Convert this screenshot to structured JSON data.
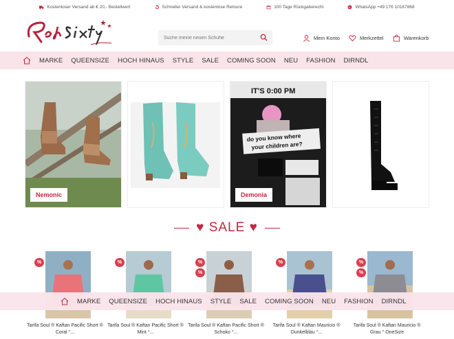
{
  "infobar": [
    {
      "icon": "truck-icon",
      "text": "Kostenloser Versand ab € 20,- Bestellwert"
    },
    {
      "icon": "return-icon",
      "text": "Schneller Versand & kostenlose Retoure"
    },
    {
      "icon": "calendar-icon",
      "text": "100 Tage Rückgaberecht"
    },
    {
      "icon": "whatsapp-icon",
      "text": "WhatsApp +49 176 10167868"
    }
  ],
  "brand": {
    "logo_text": "Red Sixty"
  },
  "search": {
    "placeholder": "Suche meine neuen Schuhe"
  },
  "account": {
    "konto": "Mein Konto",
    "merkzettel": "Merkzettel",
    "warenkorb": "Warenkorb"
  },
  "nav": [
    "MARKE",
    "QUEENSIZE",
    "HOCH HINAUS",
    "STYLE",
    "SALE",
    "COMING SOON",
    "NEU",
    "FASHION",
    "DIRNDL"
  ],
  "tiles": [
    {
      "label": "Nemonic"
    },
    {
      "label": ""
    },
    {
      "label": "Demonia",
      "poster_lines": [
        "IT'S 0:00 PM",
        "do you know where",
        "your children are?"
      ]
    },
    {
      "label": ""
    }
  ],
  "sale": {
    "title": "♥ SALE ♥"
  },
  "products": [
    {
      "badges": [
        "%"
      ],
      "name_line1": "Tarifa Soul ® Kaftan Pacific Short ®",
      "name_line2": "Coral °..."
    },
    {
      "badges": [
        "%"
      ],
      "name_line1": "Tarifa Soul ® Kaftan Pacific Short ®",
      "name_line2": "Mint °..."
    },
    {
      "badges": [
        "%",
        "%"
      ],
      "name_line1": "Tarifa Soul ® Kaftan Pacific Short ®",
      "name_line2": "Schoko °..."
    },
    {
      "badges": [
        "%"
      ],
      "name_line1": "Tarifa Soul ® Kaftan Mauricio ®",
      "name_line2": "Dunkelblau °..."
    },
    {
      "badges": [
        "%",
        "%"
      ],
      "name_line1": "Tarifa Soul ® Kaftan Mauricio ®",
      "name_line2": "Grau ° OneSize"
    }
  ],
  "colors": {
    "accent": "#c0283f",
    "nav_bg": "#f9e4ea",
    "badge": "#d9404f"
  }
}
